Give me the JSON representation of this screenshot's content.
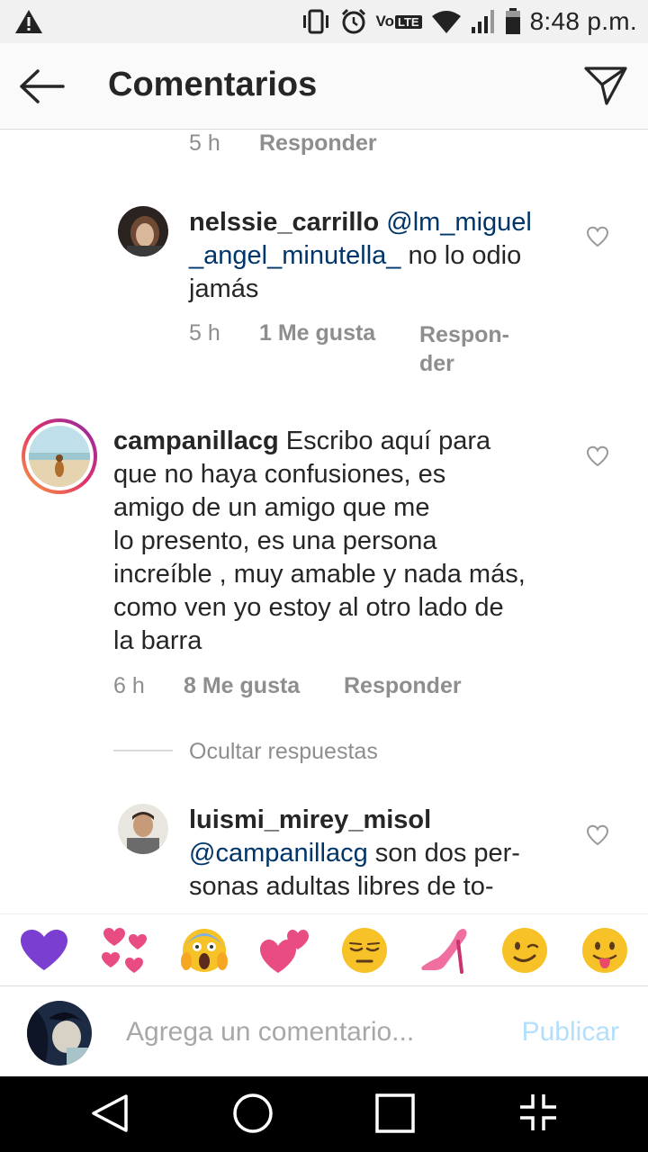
{
  "status": {
    "time": "8:48 p.m.",
    "volte": "Vo",
    "lte": "LTE"
  },
  "header": {
    "title": "Comentarios"
  },
  "comments": [
    {
      "time": "5 h",
      "reply": "Responder"
    },
    {
      "user": "nelssie_carrillo",
      "mention_line1": "@lm_miguel",
      "mention_line2": "_angel_minutella_",
      "text_line2": " no lo odio",
      "text_line3": "jamás",
      "time": "5 h",
      "likes": "1 Me gusta",
      "reply_line1": "Respon-",
      "reply_line2": "der"
    },
    {
      "user": "campanillacg",
      "lines": [
        " Escribo aquí para",
        "que no haya confusiones, es",
        "amigo de un amigo que me",
        "lo presento, es una persona",
        "increíble , muy amable y nada más,",
        "como ven yo estoy al otro lado de",
        "la barra"
      ],
      "time": "6 h",
      "likes": "8 Me gusta",
      "reply": "Responder",
      "hide_replies": "Ocultar respuestas"
    },
    {
      "user": "luismi_mirey_misol",
      "mention": "@campanillacg",
      "line2_rest": " son dos per-",
      "line3": "sonas adultas libres de to-"
    }
  ],
  "emojis": [
    "purple-heart",
    "hearts-cluster",
    "screaming-face",
    "two-hearts",
    "unamused-face",
    "high-heel",
    "winking-face",
    "tongue-face"
  ],
  "composer": {
    "placeholder": "Agrega un comentario...",
    "publish": "Publicar"
  }
}
